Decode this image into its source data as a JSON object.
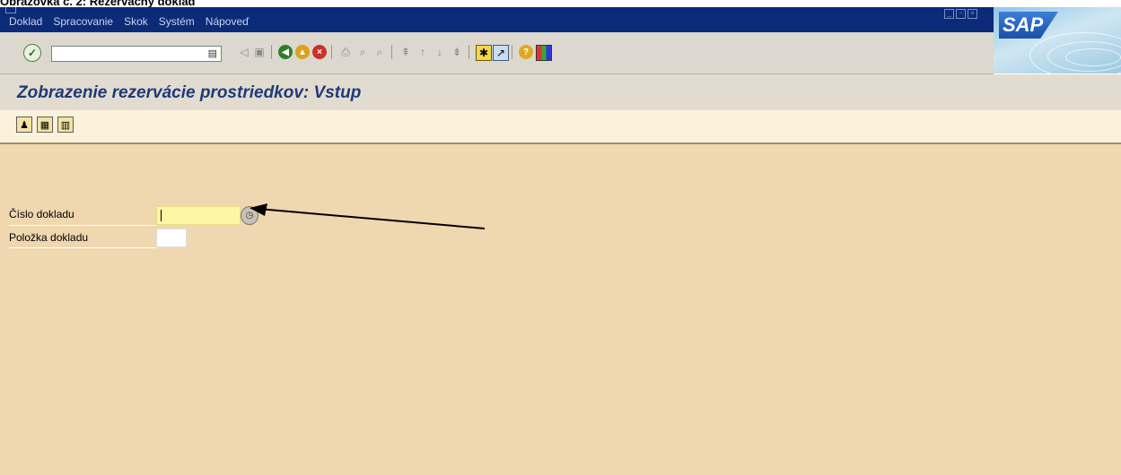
{
  "caption": "Obrazovka č. 2: Rezervačný doklad",
  "menu": {
    "items": [
      "Doklad",
      "Spracovanie",
      "Skok",
      "Systém",
      "Nápoveď"
    ]
  },
  "toolbar": {
    "command_field_value": "",
    "icons": [
      "enter-check-icon",
      "back-icon",
      "save-icon",
      "back-green-icon",
      "exit-icon",
      "cancel-icon",
      "print-icon",
      "find-icon",
      "find-next-icon",
      "first-page-icon",
      "prev-page-icon",
      "next-page-icon",
      "last-page-icon",
      "new-session-icon",
      "shortcut-icon",
      "help-icon",
      "layout-icon"
    ]
  },
  "title": "Zobrazenie rezervácie prostriedkov: Vstup",
  "app_toolbar": {
    "icons": [
      "person-icon",
      "document-icon",
      "table-icon"
    ]
  },
  "form": {
    "doc_number_label": "Číslo dokladu",
    "doc_number_value": "",
    "doc_item_label": "Položka dokladu",
    "doc_item_value": ""
  },
  "logo_text": "SAP",
  "colors": {
    "menubar": "#0b2a78",
    "title": "#1f3a7a",
    "content_bg": "#efd7b0",
    "required_field": "#fdf6a3"
  }
}
